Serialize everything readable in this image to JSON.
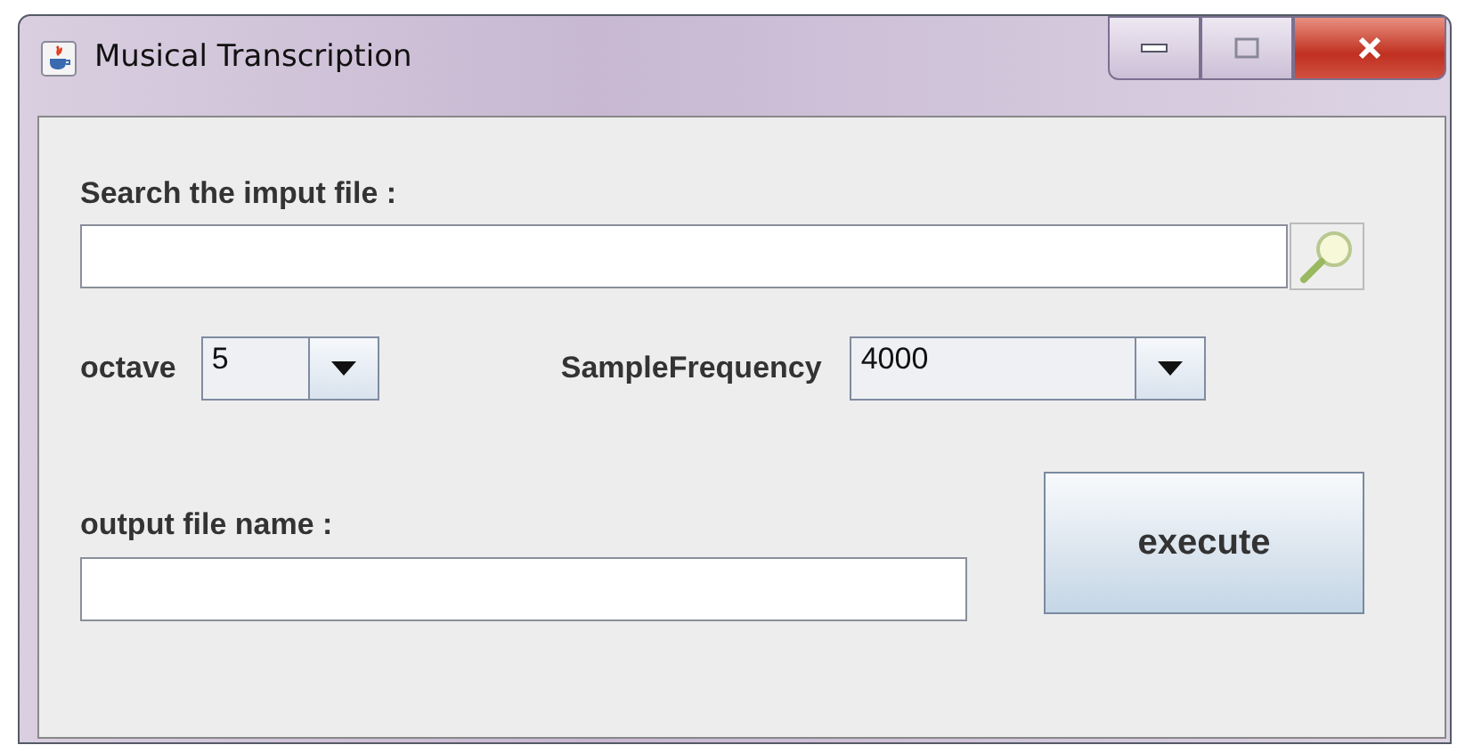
{
  "window": {
    "title": "Musical Transcription"
  },
  "input_file": {
    "label": "Search the imput file :"
  },
  "octave": {
    "label": "octave",
    "value": "5"
  },
  "sample_frequency": {
    "label": "SampleFrequency",
    "value": "4000"
  },
  "output_file": {
    "label": "output file name :"
  },
  "buttons": [
    "execute"
  ]
}
